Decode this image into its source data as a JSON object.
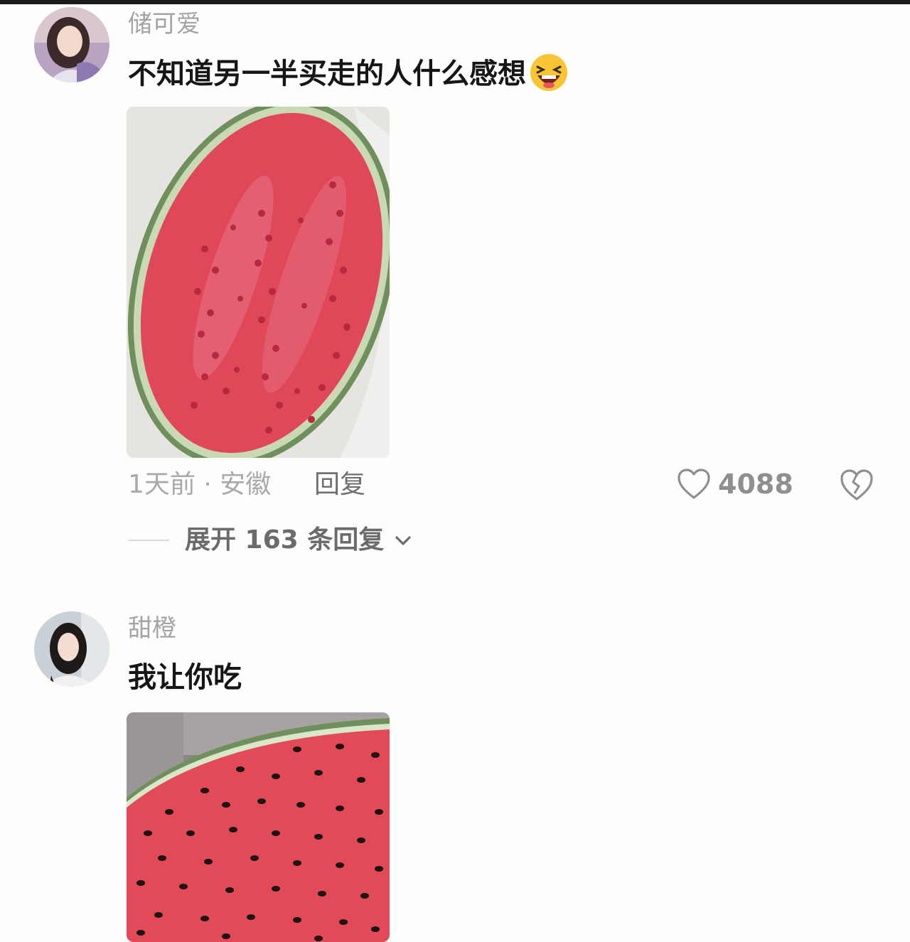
{
  "comments": [
    {
      "username": "储可爱",
      "text": "不知道另一半买走的人什么感想",
      "emoji": "laughing-emoji",
      "image": "watermelon-half-hollowed",
      "meta": "1天前 · 安徽",
      "reply_label": "回复",
      "likes": "4088",
      "expand_label": "展开 163 条回复"
    },
    {
      "username": "甜橙",
      "text": "我让你吃",
      "image": "watermelon-seeded-flesh"
    }
  ],
  "colors": {
    "watermelon_red": "#e0485a",
    "rind_green": "#6f8f5c",
    "text_muted": "#a4a4a4"
  }
}
